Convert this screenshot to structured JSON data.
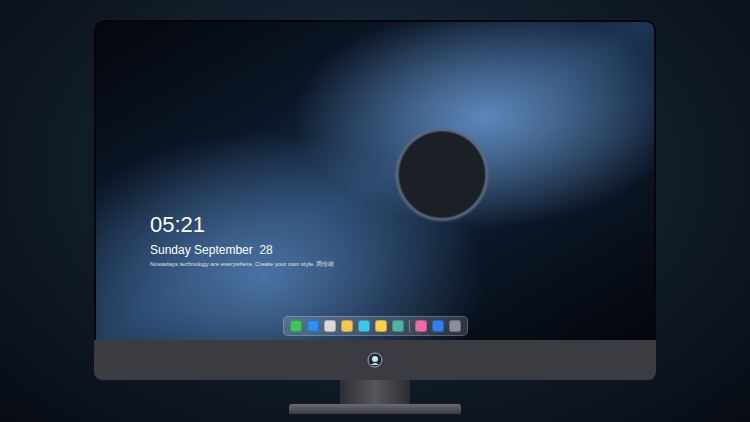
{
  "lock_screen": {
    "time": "05:21",
    "date": "Sunday September  28",
    "quote": "Nowadays technology are everywhere. Create your own style. 周传雄"
  },
  "dock": {
    "apps": [
      {
        "color": "#3fc35a"
      },
      {
        "color": "#2f8ff0"
      },
      {
        "color": "#d9d9d9"
      },
      {
        "color": "#f2c94c"
      },
      {
        "color": "#3cc6e8"
      },
      {
        "color": "#f5d547"
      },
      {
        "color": "#4fb3a4"
      },
      {
        "color": "#f06aa8"
      },
      {
        "color": "#2f7ff0"
      },
      {
        "color": "#8a8f99"
      }
    ]
  }
}
